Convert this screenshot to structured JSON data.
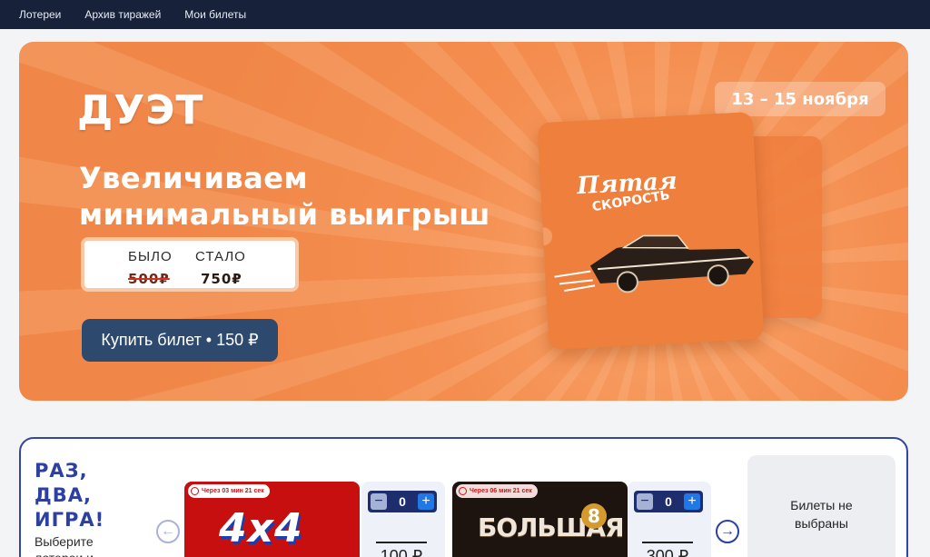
{
  "nav": {
    "items": [
      "Лотереи",
      "Архив тиражей",
      "Мои билеты"
    ]
  },
  "banner": {
    "brand": "ДУЭТ",
    "headline_line1": "Увеличиваем",
    "headline_line2": "минимальный выигрыш",
    "date": "13 – 15 ноября",
    "compare": {
      "was_label": "БЫЛО",
      "now_label": "СТАЛО",
      "was_value": "500₽",
      "now_value": "750₽"
    },
    "buy_button": "Купить билет • 150 ₽",
    "ticket_title_1": "Пятая",
    "ticket_title_2": "СКОРОСТЬ"
  },
  "panel": {
    "title_line1": "РАЗ,",
    "title_line2": "ДВА,",
    "title_line3": "ИГРА!",
    "subtitle": "Выберите лотереи и",
    "lotteries": [
      {
        "timer": "Через 03 мин 21 сек",
        "logo": "4x4",
        "qty": "0",
        "price": "100 ₽"
      },
      {
        "timer": "Через 06 мин 21 сек",
        "logo": "БОЛЬШАЯ",
        "logo_ball": "8",
        "qty": "0",
        "price": "300 ₽"
      }
    ],
    "summary": "Билеты не выбраны",
    "minus_glyph": "−",
    "plus_glyph": "+",
    "prev_glyph": "←",
    "next_glyph": "→"
  },
  "colors": {
    "nav_bg": "#17223a",
    "banner_orange": "#f08748",
    "button_blue": "#2d4a6e",
    "panel_border": "#3346a6",
    "card_red": "#c80f0f"
  }
}
